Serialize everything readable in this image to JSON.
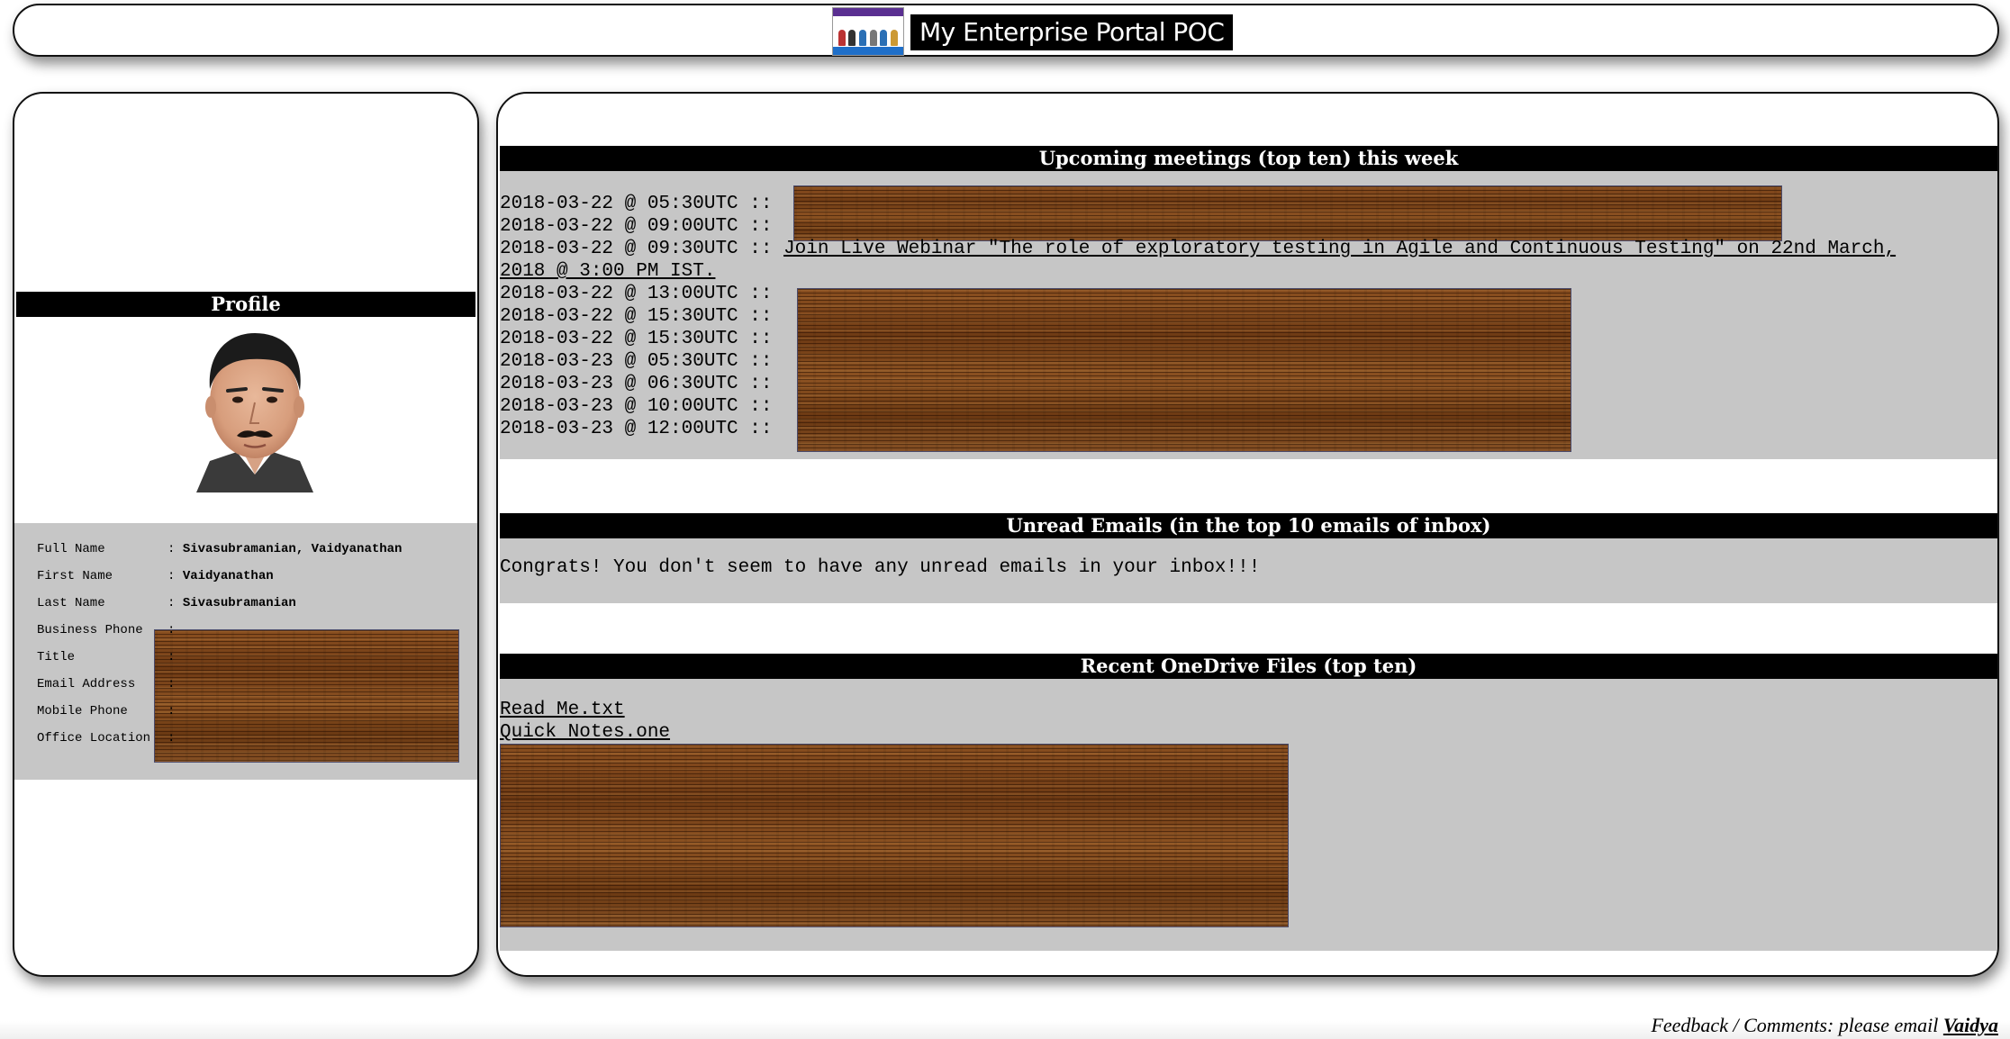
{
  "header": {
    "title": "My Enterprise Portal POC",
    "logo_icon": "team-logo-icon"
  },
  "sidebar": {
    "section_title": "Profile",
    "avatar_icon": "profile-photo",
    "fields": [
      {
        "label": "Full Name",
        "value": "Sivasubramanian, Vaidyanathan"
      },
      {
        "label": "First Name",
        "value": "Vaidyanathan"
      },
      {
        "label": "Last Name",
        "value": "Sivasubramanian"
      },
      {
        "label": "Business Phone",
        "value": ""
      },
      {
        "label": "Title",
        "value": ""
      },
      {
        "label": "Email Address",
        "value": ""
      },
      {
        "label": "Mobile Phone",
        "value": ""
      },
      {
        "label": "Office Location",
        "value": ""
      }
    ]
  },
  "meetings": {
    "section_title": "Upcoming meetings (top ten) this week",
    "items": [
      {
        "time": "2018-03-22 @ 05:30UTC ::",
        "subject": ""
      },
      {
        "time": "2018-03-22 @ 09:00UTC ::",
        "subject": ""
      },
      {
        "time": "2018-03-22 @ 09:30UTC ::",
        "subject": "Join Live Webinar \"The role of exploratory testing in Agile and Continuous Testing\" on 22nd March,",
        "subject_cont": "2018 @ 3:00 PM IST."
      },
      {
        "time": "2018-03-22 @ 13:00UTC ::",
        "subject": ""
      },
      {
        "time": "2018-03-22 @ 15:30UTC ::",
        "subject": ""
      },
      {
        "time": "2018-03-22 @ 15:30UTC ::",
        "subject": ""
      },
      {
        "time": "2018-03-23 @ 05:30UTC ::",
        "subject": ""
      },
      {
        "time": "2018-03-23 @ 06:30UTC ::",
        "subject": ""
      },
      {
        "time": "2018-03-23 @ 10:00UTC ::",
        "subject": ""
      },
      {
        "time": "2018-03-23 @ 12:00UTC ::",
        "subject": ""
      }
    ]
  },
  "emails": {
    "section_title": "Unread Emails (in the top 10 emails of inbox)",
    "message": "Congrats! You don't seem to have any unread emails in your inbox!!!"
  },
  "onedrive": {
    "section_title": "Recent OneDrive Files (top ten)",
    "files": [
      "Read Me.txt",
      "Quick Notes.one"
    ]
  },
  "footer": {
    "text": "Feedback / Comments: please email ",
    "link": "Vaidya"
  }
}
